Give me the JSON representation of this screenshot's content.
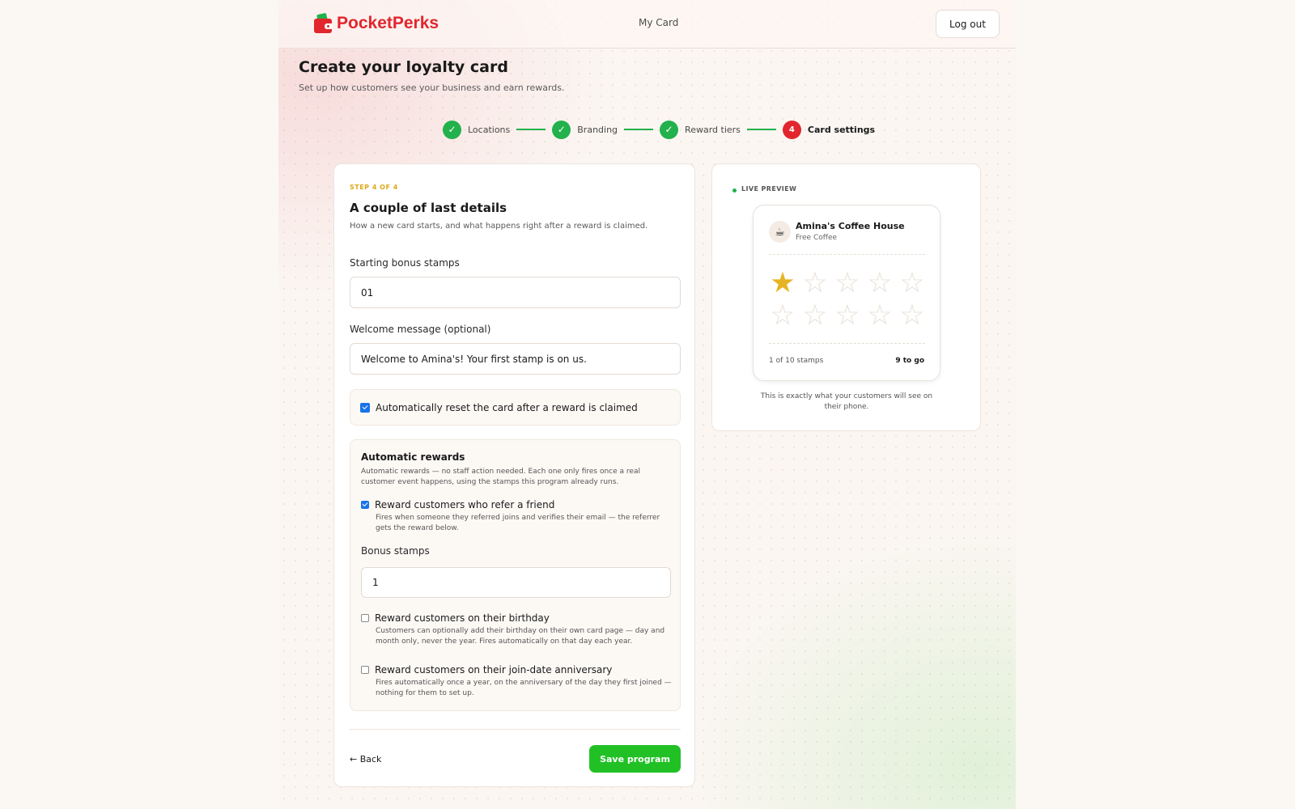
{
  "header": {
    "logo_part1": "Pocket",
    "logo_part2": "Perks",
    "nav_my_card": "My Card",
    "logout_label": "Log out"
  },
  "page": {
    "title": "Create your loyalty card",
    "subtitle": "Set up how customers see your business and earn rewards."
  },
  "stepper": {
    "steps": [
      {
        "label": "Locations",
        "state": "done",
        "marker": "✓"
      },
      {
        "label": "Branding",
        "state": "done",
        "marker": "✓"
      },
      {
        "label": "Reward tiers",
        "state": "done",
        "marker": "✓"
      },
      {
        "label": "Card settings",
        "state": "active",
        "marker": "4"
      }
    ],
    "done_color": "#22b14c",
    "active_color": "#e1262d"
  },
  "form": {
    "step_of": "STEP 4 OF 4",
    "title": "A couple of last details",
    "description": "How a new card starts, and what happens right after a reward is claimed.",
    "starting_bonus_label": "Starting bonus stamps",
    "starting_bonus_value": "01",
    "welcome_label": "Welcome message (optional)",
    "welcome_value": "Welcome to Amina's! Your first stamp is on us.",
    "auto_reset": {
      "label": "Automatically reset the card after a reward is claimed",
      "checked": true
    },
    "automatic_rewards": {
      "title": "Automatic rewards",
      "description": "Automatic rewards — no staff action needed. Each one only fires once a real customer event happens, using the stamps this program already runs.",
      "referral": {
        "label": "Reward customers who refer a friend",
        "description": "Fires when someone they referred joins and verifies their email — the referrer gets the reward below.",
        "checked": true
      },
      "bonus_stamps_label": "Bonus stamps",
      "bonus_stamps_value": "1",
      "birthday": {
        "label": "Reward customers on their birthday",
        "description": "Customers can optionally add their birthday on their own card page — day and month only, never the year. Fires automatically on that day each year.",
        "checked": false
      },
      "anniversary": {
        "label": "Reward customers on their join-date anniversary",
        "description": "Fires automatically once a year, on the anniversary of the day they first joined — nothing for them to set up.",
        "checked": false
      }
    },
    "back_label": "← Back",
    "save_label": "Save program",
    "save_color": "#21c125"
  },
  "preview": {
    "label": "LIVE PREVIEW",
    "business_name": "Amina's Coffee House",
    "reward_name": "Free Coffee",
    "avatar_icon": "coffee-cup-icon",
    "stamps_filled": 1,
    "stamps_total": 10,
    "stamp_count_text": "1 of 10 stamps",
    "to_go_text": "9 to go",
    "star_filled_color": "#e6b422",
    "caption": "This is exactly what your customers will see on their phone."
  }
}
